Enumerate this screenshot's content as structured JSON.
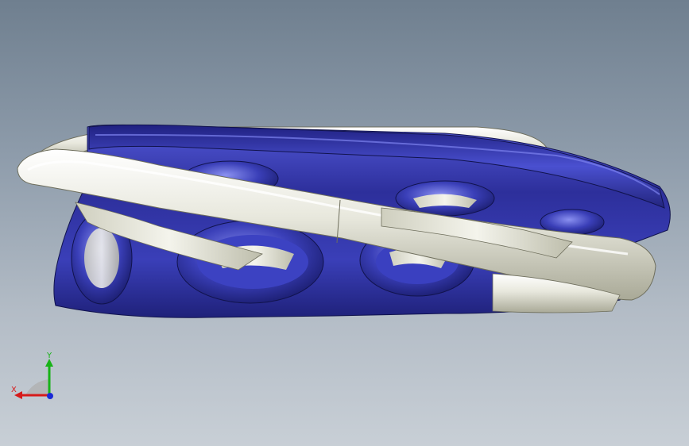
{
  "viewport": {
    "background_top": "#6f7f8f",
    "background_bottom": "#c8cfd6"
  },
  "model": {
    "primary_color": "#2d2f9b",
    "secondary_color": "#e8e8dd"
  },
  "triad": {
    "x_label": "X",
    "y_label": "Y",
    "x_color": "#d61a1a",
    "y_color": "#17b317",
    "z_color": "#1a2ad6"
  }
}
